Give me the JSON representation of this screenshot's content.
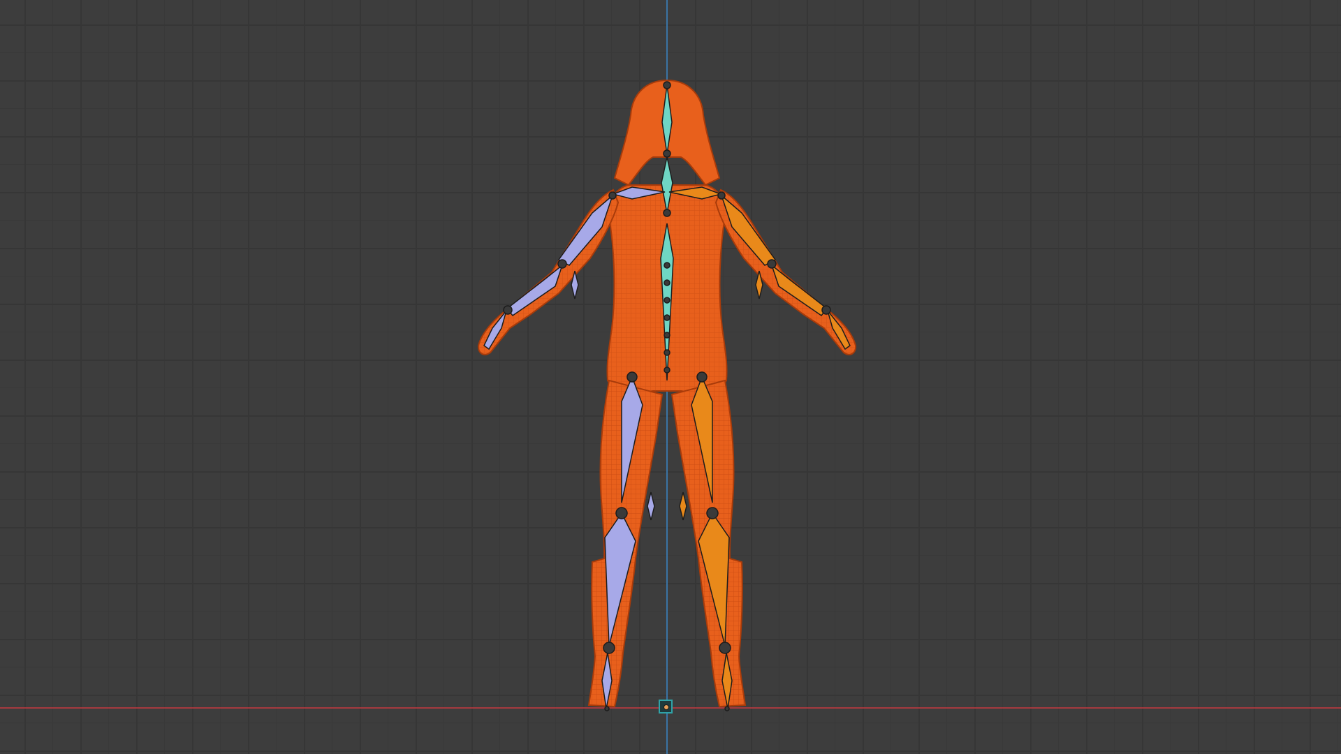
{
  "viewport": {
    "mode": "front-orthographic",
    "grid": true,
    "background_color": "#3d3d3d"
  },
  "axes": {
    "x_axis_color": "#b8393f",
    "z_axis_color": "#3b7fb8"
  },
  "mesh": {
    "object_type": "humanoid-character",
    "display": "wireframe-selected",
    "color": "#e8601c"
  },
  "armature": {
    "center_bone_color": "#6fd6c4",
    "right_side_bone_color": "#a7a9e8",
    "left_side_bone_color": "#e9891a"
  },
  "origin": {
    "icon": "object-origin-icon",
    "color": "#2fa3a8"
  }
}
